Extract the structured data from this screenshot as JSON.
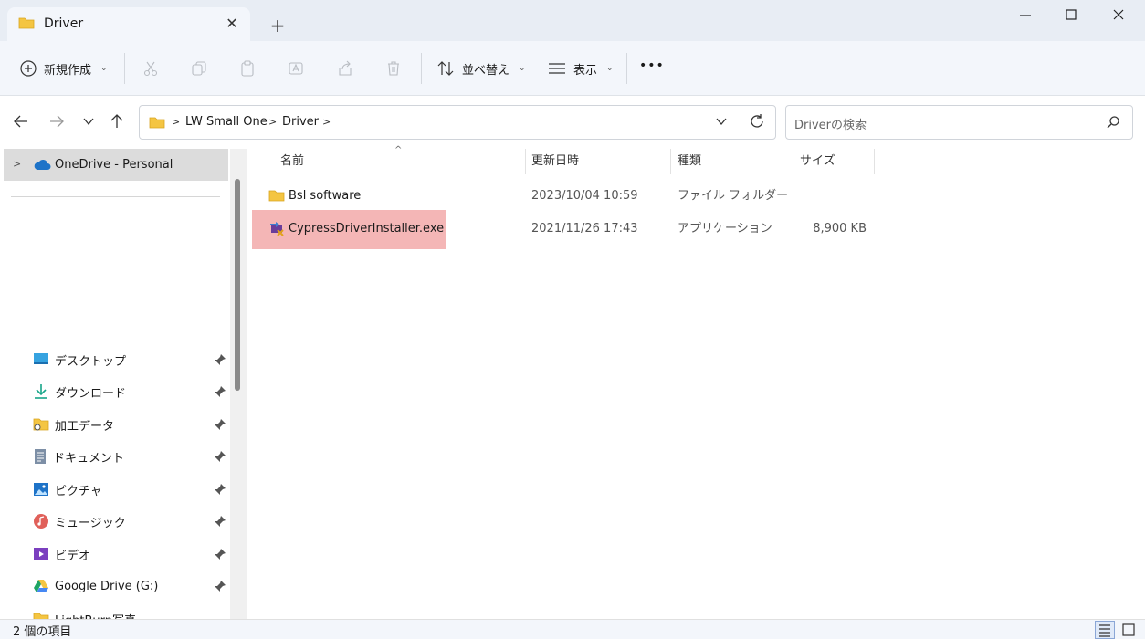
{
  "window": {
    "tab_title": "Driver",
    "tab_close": "✕",
    "new_tab": "+"
  },
  "toolbar": {
    "new_label": "新規作成",
    "sort_label": "並べ替え",
    "view_label": "表示",
    "more_label": "•••"
  },
  "address": {
    "crumbs": [
      "LW Small One",
      "Driver"
    ],
    "search_placeholder": "Driverの検索"
  },
  "sidebar": {
    "onedrive": "OneDrive - Personal",
    "items": [
      {
        "label": "デスクトップ",
        "icon": "desktop-icon"
      },
      {
        "label": "ダウンロード",
        "icon": "download-icon"
      },
      {
        "label": "加工データ",
        "icon": "folder-icon"
      },
      {
        "label": "ドキュメント",
        "icon": "document-icon"
      },
      {
        "label": "ピクチャ",
        "icon": "picture-icon"
      },
      {
        "label": "ミュージック",
        "icon": "music-icon"
      },
      {
        "label": "ビデオ",
        "icon": "video-icon"
      },
      {
        "label": "Google Drive (G:)",
        "icon": "google-drive-icon"
      },
      {
        "label": "LightBurn写真",
        "icon": "folder-icon"
      }
    ]
  },
  "filelist": {
    "columns": {
      "name": "名前",
      "modified": "更新日時",
      "type": "種類",
      "size": "サイズ"
    },
    "rows": [
      {
        "name": "Bsl software",
        "modified": "2023/10/04 10:59",
        "type": "ファイル フォルダー",
        "size": ""
      },
      {
        "name": "CypressDriverInstaller.exe",
        "modified": "2021/11/26 17:43",
        "type": "アプリケーション",
        "size": "8,900 KB"
      }
    ]
  },
  "status": {
    "item_count": "2 個の項目"
  },
  "colors": {
    "selection_highlight": "#f4b6b6",
    "folder_yellow": "#f4c542",
    "accent_blue": "#1e73c8"
  }
}
